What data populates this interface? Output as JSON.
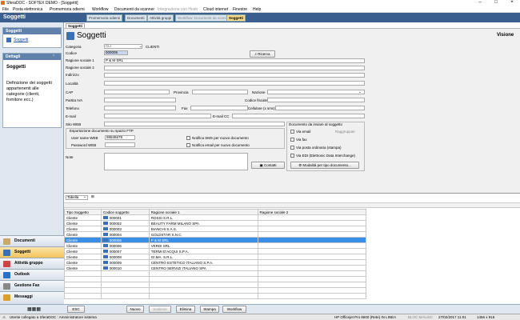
{
  "window": {
    "title": "SferaDOC - SOFTEX DEMO - [Soggetti]"
  },
  "menu": [
    "File",
    "Posta elettronica",
    "Promemoria odierni",
    "Workflow",
    "Documenti da scanner",
    "Integrazione con Hosti",
    "Cloud internet",
    "Finestre",
    "Help"
  ],
  "sidebar": {
    "title": "Soggetti",
    "panel1_title": "Soggetti",
    "panel1_item": "Soggetti",
    "dettagli_title": "Dettagli",
    "dettagli_heading": "Soggetti",
    "dettagli_text": "Definizione dei soggetti appartenenti alle categorie (clienti, fornitore ecc.)",
    "nav": [
      "Documenti",
      "Soggetti",
      "Attività gruppo",
      "Outlook",
      "Gestione Fax",
      "Messaggi"
    ]
  },
  "tabs": [
    "Promemoria odierni",
    "Documenti",
    "Attività gruppi",
    "Workflow: Documenti da scanner",
    "Soggetti"
  ],
  "subtab": "Soggetti",
  "form": {
    "title": "Soggetti",
    "visione": "Visione",
    "categoria_label": "Categoria",
    "categoria_code": "CLI",
    "categoria_desc": "CLIENTI",
    "codice_label": "Codice",
    "codice_value": "000005",
    "ricerca": "Ricerca",
    "ragione1_label": "Ragione sociale 1",
    "ragione1_value": "P & M SRL",
    "ragione2_label": "Ragione sociale 2",
    "indirizzo_label": "Indirizzo",
    "localita_label": "Località",
    "cap_label": "CAP",
    "provincia_label": "Provincia",
    "nazione_label": "Nazione",
    "piva_label": "Partita IVA",
    "cf_label": "Codice fiscale",
    "telefono_label": "Telefono",
    "fax_label": "Fax",
    "cellulare_label": "Cellulare (x sms)",
    "email_label": "E-mail",
    "emailcc_label": "E-mail CC",
    "sito_label": "Sito WEB",
    "ftp_title": "Esportazione documento su spazio FTP",
    "username_label": "User name WEB",
    "username_value": "98846678",
    "password_label": "Password WEB",
    "notifica_sms": "Notifica SMS per nuovo documento",
    "notifica_email": "Notifica email per nuovo documento",
    "note_label": "Note",
    "contatti": "Contatti",
    "invio_title": "Documento da inviare al soggetto",
    "via_email": "Via email",
    "raggruppati": "Raggruppati",
    "via_fax": "Via fax",
    "via_posta": "Via posta ordinaria (stampa)",
    "via_edi": "Via EDI (Elettronic Data Interchange)",
    "modalita": "Modalità per tipo documento..."
  },
  "grid": {
    "view_select": "Tabella",
    "columns": [
      "Tipo Soggetto",
      "Codice soggetto",
      "Ragione sociale 1",
      "Ragione sociale 2"
    ],
    "rows": [
      [
        "Cliente",
        "000001",
        "ROSSI S.R.L.",
        ""
      ],
      [
        "Cliente",
        "000002",
        "BEAUTY FARM MILANO SPA",
        ""
      ],
      [
        "Cliente",
        "000003",
        "BIANCHI S.A.S.",
        ""
      ],
      [
        "Cliente",
        "000004",
        "GOLDSTAR S.N.C.",
        ""
      ],
      [
        "Cliente",
        "000005",
        "P & M SRL",
        ""
      ],
      [
        "Cliente",
        "000006",
        "VERDI SRL",
        ""
      ],
      [
        "Cliente",
        "000007",
        "TERMI D'ACQUI S.P.A.",
        ""
      ],
      [
        "Cliente",
        "000008",
        "GI.MA. S.R.L.",
        ""
      ],
      [
        "Cliente",
        "000009",
        "CENTRO ESTETICO ITALIANO S.P.A.",
        ""
      ],
      [
        "Cliente",
        "000010",
        "CENTRO SERVIZI ITALIANO SPA",
        ""
      ]
    ],
    "selected_row": 4
  },
  "bottom_buttons": [
    "ESC",
    "Nuovo",
    "Sostiene",
    "Elimina",
    "Stampa",
    "Workflow"
  ],
  "status": {
    "left": "Utente collegato a SferaDOC : Amministratore sistema",
    "printer": "HP Officejet Pro 8600 (Rete) IN LINEA",
    "mode": "BLOC MAIUSC",
    "datetime": "27/02/2017 11:01",
    "res": "1456 x 916"
  },
  "colors": {
    "header_blue": "#3a5f8f",
    "selection": "#3a8ee6",
    "active_tab": "#f7d98a"
  }
}
